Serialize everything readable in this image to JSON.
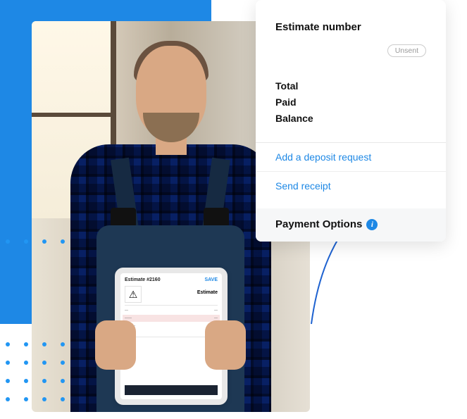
{
  "card": {
    "heading": "Estimate number",
    "status_badge": "Unsent",
    "summary": {
      "total_label": "Total",
      "paid_label": "Paid",
      "balance_label": "Balance"
    },
    "links": {
      "add_deposit": "Add a deposit request",
      "send_receipt": "Send receipt"
    },
    "payment_options_label": "Payment Options",
    "info_icon_glyph": "i"
  },
  "tablet": {
    "header_title": "Estimate #2160",
    "header_action": "SAVE",
    "logo_glyph": "⚠",
    "doc_title": "Estimate"
  }
}
